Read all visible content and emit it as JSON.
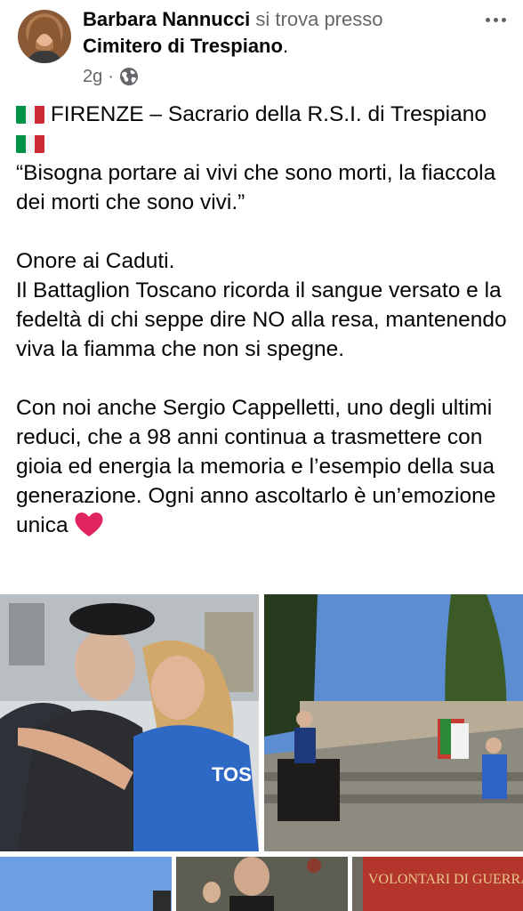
{
  "post": {
    "author_name": "Barbara Nannucci",
    "location_prefix": "si trova presso",
    "location_name": "Cimitero di Trespiano",
    "location_suffix": ".",
    "timestamp": "2g",
    "separator": "·",
    "privacy_icon": "globe-icon",
    "more_icon": "more-options-icon",
    "body": {
      "line1_text": "FIRENZE – Sacrario della R.S.I. di Trespiano",
      "quote": "“Bisogna portare ai vivi che sono morti, la fiaccola dei morti che sono vivi.”",
      "onore": "Onore ai Caduti.",
      "paragraph2": "Il Battaglion Toscano ricorda il sangue versato e la fedeltà di chi seppe dire NO alla resa, mantenendo viva la fiamma che non si spegne.",
      "paragraph3": "Con noi anche Sergio Cappelletti, uno degli ultimi reduci, che a 98 anni continua a trasmettere con gioia ed energia la memoria e l’esempio della sua generazione. Ogni anno ascoltarlo è un’emozione unica",
      "emoji": [
        "italy-flag",
        "italy-flag",
        "red-heart"
      ]
    },
    "photos": {
      "banner_text": "VOLONTARI DI GUERRA",
      "shirt_text": "TOS"
    }
  },
  "colors": {
    "text": "#050505",
    "secondary": "#65676b",
    "flag_green": "#009246",
    "flag_white": "#ffffff",
    "flag_red": "#ce2b37",
    "heart": "#e0245e"
  }
}
